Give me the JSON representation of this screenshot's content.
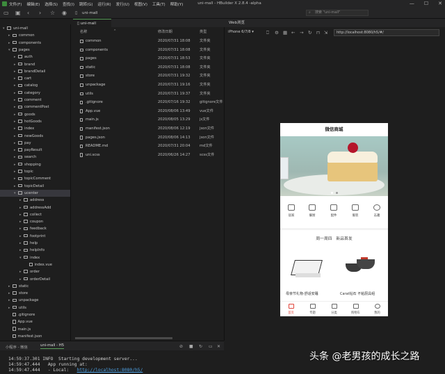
{
  "menubar": {
    "items": [
      "文件(F)",
      "编辑(E)",
      "选择(S)",
      "查找(I)",
      "跳转(G)",
      "运行(R)",
      "发行(U)",
      "视图(V)",
      "工具(T)",
      "帮助(Y)"
    ],
    "window_title": "uni-mall - HBuilder X 2.8.4 -alpha",
    "controls": [
      "—",
      "☐",
      "✕"
    ]
  },
  "toolbar": {
    "breadcrumb": "uni-mall",
    "search_placeholder": "搜索 \"uni-mall\""
  },
  "tabs": {
    "file_tab": "uni-mall",
    "web_tab": "Web浏览器"
  },
  "sidebar": {
    "items": [
      {
        "label": "uni-mall",
        "level": 0,
        "kind": "root",
        "open": true
      },
      {
        "label": "common",
        "level": 1,
        "kind": "folder"
      },
      {
        "label": "components",
        "level": 1,
        "kind": "folder"
      },
      {
        "label": "pages",
        "level": 1,
        "kind": "folder",
        "open": true
      },
      {
        "label": "auth",
        "level": 2,
        "kind": "folder"
      },
      {
        "label": "brand",
        "level": 2,
        "kind": "folder"
      },
      {
        "label": "brandDetail",
        "level": 2,
        "kind": "folder"
      },
      {
        "label": "cart",
        "level": 2,
        "kind": "folder"
      },
      {
        "label": "catalog",
        "level": 2,
        "kind": "folder"
      },
      {
        "label": "category",
        "level": 2,
        "kind": "folder"
      },
      {
        "label": "comment",
        "level": 2,
        "kind": "folder"
      },
      {
        "label": "commentPost",
        "level": 2,
        "kind": "folder"
      },
      {
        "label": "goods",
        "level": 2,
        "kind": "folder"
      },
      {
        "label": "hotGoods",
        "level": 2,
        "kind": "folder"
      },
      {
        "label": "index",
        "level": 2,
        "kind": "folder"
      },
      {
        "label": "newGoods",
        "level": 2,
        "kind": "folder"
      },
      {
        "label": "pay",
        "level": 2,
        "kind": "folder"
      },
      {
        "label": "payResult",
        "level": 2,
        "kind": "folder"
      },
      {
        "label": "search",
        "level": 2,
        "kind": "folder"
      },
      {
        "label": "shopping",
        "level": 2,
        "kind": "folder"
      },
      {
        "label": "topic",
        "level": 2,
        "kind": "folder"
      },
      {
        "label": "topicComment",
        "level": 2,
        "kind": "folder"
      },
      {
        "label": "topicDetail",
        "level": 2,
        "kind": "folder"
      },
      {
        "label": "ucenter",
        "level": 2,
        "kind": "folder",
        "open": true,
        "selected": true
      },
      {
        "label": "address",
        "level": 3,
        "kind": "folder"
      },
      {
        "label": "addressAdd",
        "level": 3,
        "kind": "folder"
      },
      {
        "label": "collect",
        "level": 3,
        "kind": "folder"
      },
      {
        "label": "coupon",
        "level": 3,
        "kind": "folder"
      },
      {
        "label": "feedback",
        "level": 3,
        "kind": "folder"
      },
      {
        "label": "footprint",
        "level": 3,
        "kind": "folder"
      },
      {
        "label": "help",
        "level": 3,
        "kind": "folder"
      },
      {
        "label": "helpInfo",
        "level": 3,
        "kind": "folder"
      },
      {
        "label": "index",
        "level": 3,
        "kind": "folder",
        "open": true
      },
      {
        "label": "index.vue",
        "level": 4,
        "kind": "file"
      },
      {
        "label": "order",
        "level": 3,
        "kind": "folder"
      },
      {
        "label": "orderDetail",
        "level": 3,
        "kind": "folder"
      },
      {
        "label": "static",
        "level": 1,
        "kind": "folder"
      },
      {
        "label": "store",
        "level": 1,
        "kind": "folder"
      },
      {
        "label": "unpackage",
        "level": 1,
        "kind": "folder"
      },
      {
        "label": "utils",
        "level": 1,
        "kind": "folder"
      },
      {
        "label": ".gitignore",
        "level": 1,
        "kind": "file"
      },
      {
        "label": "App.vue",
        "level": 1,
        "kind": "file"
      },
      {
        "label": "main.js",
        "level": 1,
        "kind": "file"
      },
      {
        "label": "manifest.json",
        "level": 1,
        "kind": "file"
      }
    ]
  },
  "filelist": {
    "headers": {
      "name": "名称",
      "date": "修改日期",
      "type": "类型"
    },
    "rows": [
      {
        "name": "common",
        "date": "2020/07/31 18:08",
        "type": "文件夹",
        "kind": "folder"
      },
      {
        "name": "components",
        "date": "2020/07/31 18:08",
        "type": "文件夹",
        "kind": "folder"
      },
      {
        "name": "pages",
        "date": "2020/07/31 18:53",
        "type": "文件夹",
        "kind": "folder"
      },
      {
        "name": "static",
        "date": "2020/07/31 18:08",
        "type": "文件夹",
        "kind": "folder"
      },
      {
        "name": "store",
        "date": "2020/07/31 19:32",
        "type": "文件夹",
        "kind": "folder"
      },
      {
        "name": "unpackage",
        "date": "2020/07/31 19:16",
        "type": "文件夹",
        "kind": "folder"
      },
      {
        "name": "utils",
        "date": "2020/07/31 19:37",
        "type": "文件夹",
        "kind": "folder"
      },
      {
        "name": ".gitignore",
        "date": "2020/07/16 19:32",
        "type": "gitignore文件",
        "kind": "file"
      },
      {
        "name": "App.vue",
        "date": "2020/08/06 13:49",
        "type": "vue文件",
        "kind": "file"
      },
      {
        "name": "main.js",
        "date": "2020/08/05 13:29",
        "type": "js文件",
        "kind": "file"
      },
      {
        "name": "manifest.json",
        "date": "2020/08/06 12:19",
        "type": "json文件",
        "kind": "file"
      },
      {
        "name": "pages.json",
        "date": "2020/08/06 14:13",
        "type": "json文件",
        "kind": "file"
      },
      {
        "name": "README.md",
        "date": "2020/07/31 20:04",
        "type": "md文件",
        "kind": "file"
      },
      {
        "name": "uni.scss",
        "date": "2020/06/26 14:27",
        "type": "scss文件",
        "kind": "file"
      }
    ]
  },
  "browser": {
    "device": "iPhone 6/7/8",
    "url": "http://localhost:8080/h5/#/"
  },
  "phone": {
    "title": "微信商城",
    "categories": [
      "居家",
      "餐厨",
      "配件",
      "服装",
      "志趣"
    ],
    "section_left": "周一周四",
    "section_right": "新品首发",
    "products": [
      "母亲节礼物-舒适安睡",
      "Carat钻石 不粘厨具组"
    ],
    "tabbar": [
      "首页",
      "专题",
      "分类",
      "购物车",
      "我的"
    ],
    "colors": {
      "accent": "#e0453b"
    }
  },
  "console": {
    "tab_left": "小程序 - 微信",
    "tab_active": "uni-mall - H5",
    "lines": [
      {
        "time": "14:59:37.301",
        "text": " INFO  Starting development server..."
      },
      {
        "time": "14:59:47.444",
        "text": "   App running at:"
      },
      {
        "time": "14:59:47.444",
        "text": "   - Local:   ",
        "link": "http://localhost:8080/h5/"
      }
    ]
  },
  "watermark": "头条 @老男孩的成长之路"
}
